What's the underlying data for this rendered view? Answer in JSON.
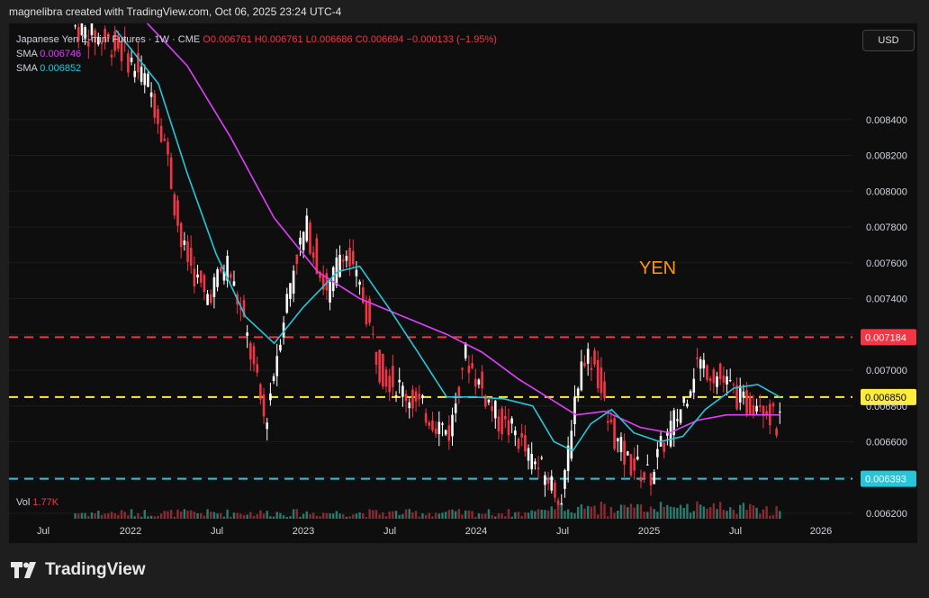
{
  "header": {
    "text": "magnelibra created with TradingView.com, Oct 06, 2025 23:24 UTC-4"
  },
  "legend": {
    "symbol": "Japanese Yen E-mini Futures · 1W · CME",
    "open": "O0.006761",
    "high": "H0.006761",
    "low": "L0.006686",
    "close": "C0.006694",
    "change": "−0.000133 (−1.95%)",
    "sma1_label": "SMA",
    "sma1_value": "0.006746",
    "sma2_label": "SMA",
    "sma2_value": "0.006852"
  },
  "currency_button": "USD",
  "annotation": "YEN",
  "volume": {
    "label": "Vol",
    "value": "1.77K"
  },
  "footer": {
    "brand": "TradingView"
  },
  "colors": {
    "up": "#ffffff",
    "down": "#f23645",
    "sma_fast": "#26c6da",
    "sma_slow": "#e040fb",
    "level_red": "#f23645",
    "level_yellow": "#ffeb3b",
    "level_cyan": "#26c6da",
    "annotation": "#ff9800"
  },
  "chart_data": {
    "type": "candlestick",
    "interval": "1W",
    "y_ticks": [
      "0.008400",
      "0.008200",
      "0.008000",
      "0.007800",
      "0.007600",
      "0.007400",
      "0.007000",
      "0.006800",
      "0.006600",
      "0.006200"
    ],
    "x_ticks": [
      "Jul",
      "2022",
      "Jul",
      "2023",
      "Jul",
      "2024",
      "Jul",
      "2025",
      "Jul",
      "2026"
    ],
    "levels": [
      {
        "value": 0.007184,
        "label": "0.007184",
        "color": "red",
        "style": "dashed"
      },
      {
        "value": 0.00685,
        "label": "0.006850",
        "color": "yellow",
        "style": "dashed"
      },
      {
        "value": 0.006393,
        "label": "0.006393",
        "color": "cyan",
        "style": "dashed"
      }
    ],
    "price_path": [
      [
        "2021-09-01",
        0.00893
      ],
      [
        "2021-12-15",
        0.0088
      ],
      [
        "2022-02-15",
        0.0086
      ],
      [
        "2022-03-20",
        0.0083
      ],
      [
        "2022-04-25",
        0.0077
      ],
      [
        "2022-06-15",
        0.0074
      ],
      [
        "2022-08-01",
        0.0076
      ],
      [
        "2022-09-10",
        0.0072
      ],
      [
        "2022-10-20",
        0.0067
      ],
      [
        "2022-11-20",
        0.0072
      ],
      [
        "2022-12-20",
        0.0076
      ],
      [
        "2023-01-15",
        0.0078
      ],
      [
        "2023-03-01",
        0.0074
      ],
      [
        "2023-04-01",
        0.0077
      ],
      [
        "2023-05-15",
        0.0074
      ],
      [
        "2023-06-20",
        0.007
      ],
      [
        "2023-08-01",
        0.0069
      ],
      [
        "2023-09-10",
        0.0068
      ],
      [
        "2023-10-20",
        0.0067
      ],
      [
        "2023-11-15",
        0.00665
      ],
      [
        "2023-12-15",
        0.0071
      ],
      [
        "2024-01-20",
        0.0069
      ],
      [
        "2024-03-01",
        0.0067
      ],
      [
        "2024-04-01",
        0.00665
      ],
      [
        "2024-05-01",
        0.0065
      ],
      [
        "2024-06-10",
        0.0064
      ],
      [
        "2024-07-10",
        0.00625
      ],
      [
        "2024-08-01",
        0.0068
      ],
      [
        "2024-08-25",
        0.0071
      ],
      [
        "2024-09-15",
        0.00705
      ],
      [
        "2024-10-15",
        0.0067
      ],
      [
        "2024-11-20",
        0.0065
      ],
      [
        "2025-01-10",
        0.0064
      ],
      [
        "2025-02-10",
        0.0066
      ],
      [
        "2025-03-20",
        0.0068
      ],
      [
        "2025-04-20",
        0.00705
      ],
      [
        "2025-05-20",
        0.007
      ],
      [
        "2025-06-30",
        0.0069
      ],
      [
        "2025-08-01",
        0.0068
      ],
      [
        "2025-09-01",
        0.00685
      ],
      [
        "2025-10-06",
        0.00669
      ]
    ],
    "sma_fast": [
      [
        "2021-12-01",
        0.0089
      ],
      [
        "2022-03-01",
        0.0086
      ],
      [
        "2022-05-01",
        0.0081
      ],
      [
        "2022-07-01",
        0.00765
      ],
      [
        "2022-09-01",
        0.0073
      ],
      [
        "2022-11-01",
        0.00715
      ],
      [
        "2023-01-01",
        0.00735
      ],
      [
        "2023-03-15",
        0.00755
      ],
      [
        "2023-05-01",
        0.00758
      ],
      [
        "2023-07-01",
        0.00735
      ],
      [
        "2023-09-01",
        0.0071
      ],
      [
        "2023-11-01",
        0.00685
      ],
      [
        "2024-01-01",
        0.00685
      ],
      [
        "2024-03-01",
        0.00684
      ],
      [
        "2024-05-01",
        0.0068
      ],
      [
        "2024-06-15",
        0.0066
      ],
      [
        "2024-07-25",
        0.00655
      ],
      [
        "2024-09-01",
        0.0067
      ],
      [
        "2024-10-15",
        0.00678
      ],
      [
        "2024-12-01",
        0.00665
      ],
      [
        "2025-01-25",
        0.0066
      ],
      [
        "2025-03-15",
        0.00663
      ],
      [
        "2025-05-01",
        0.00678
      ],
      [
        "2025-07-01",
        0.0069
      ],
      [
        "2025-08-20",
        0.00692
      ],
      [
        "2025-10-06",
        0.00685
      ]
    ],
    "sma_slow": [
      [
        "2022-02-01",
        0.00895
      ],
      [
        "2022-05-01",
        0.0087
      ],
      [
        "2022-08-01",
        0.0083
      ],
      [
        "2022-11-01",
        0.00785
      ],
      [
        "2023-02-01",
        0.00755
      ],
      [
        "2023-05-01",
        0.0074
      ],
      [
        "2023-08-01",
        0.0073
      ],
      [
        "2023-11-01",
        0.0072
      ],
      [
        "2024-01-15",
        0.0071
      ],
      [
        "2024-04-01",
        0.00695
      ],
      [
        "2024-06-01",
        0.00685
      ],
      [
        "2024-08-01",
        0.00675
      ],
      [
        "2024-10-01",
        0.00677
      ],
      [
        "2024-12-15",
        0.00668
      ],
      [
        "2025-02-15",
        0.00665
      ],
      [
        "2025-04-15",
        0.00672
      ],
      [
        "2025-06-15",
        0.00675
      ],
      [
        "2025-08-15",
        0.00675
      ],
      [
        "2025-10-06",
        0.00675
      ]
    ]
  }
}
